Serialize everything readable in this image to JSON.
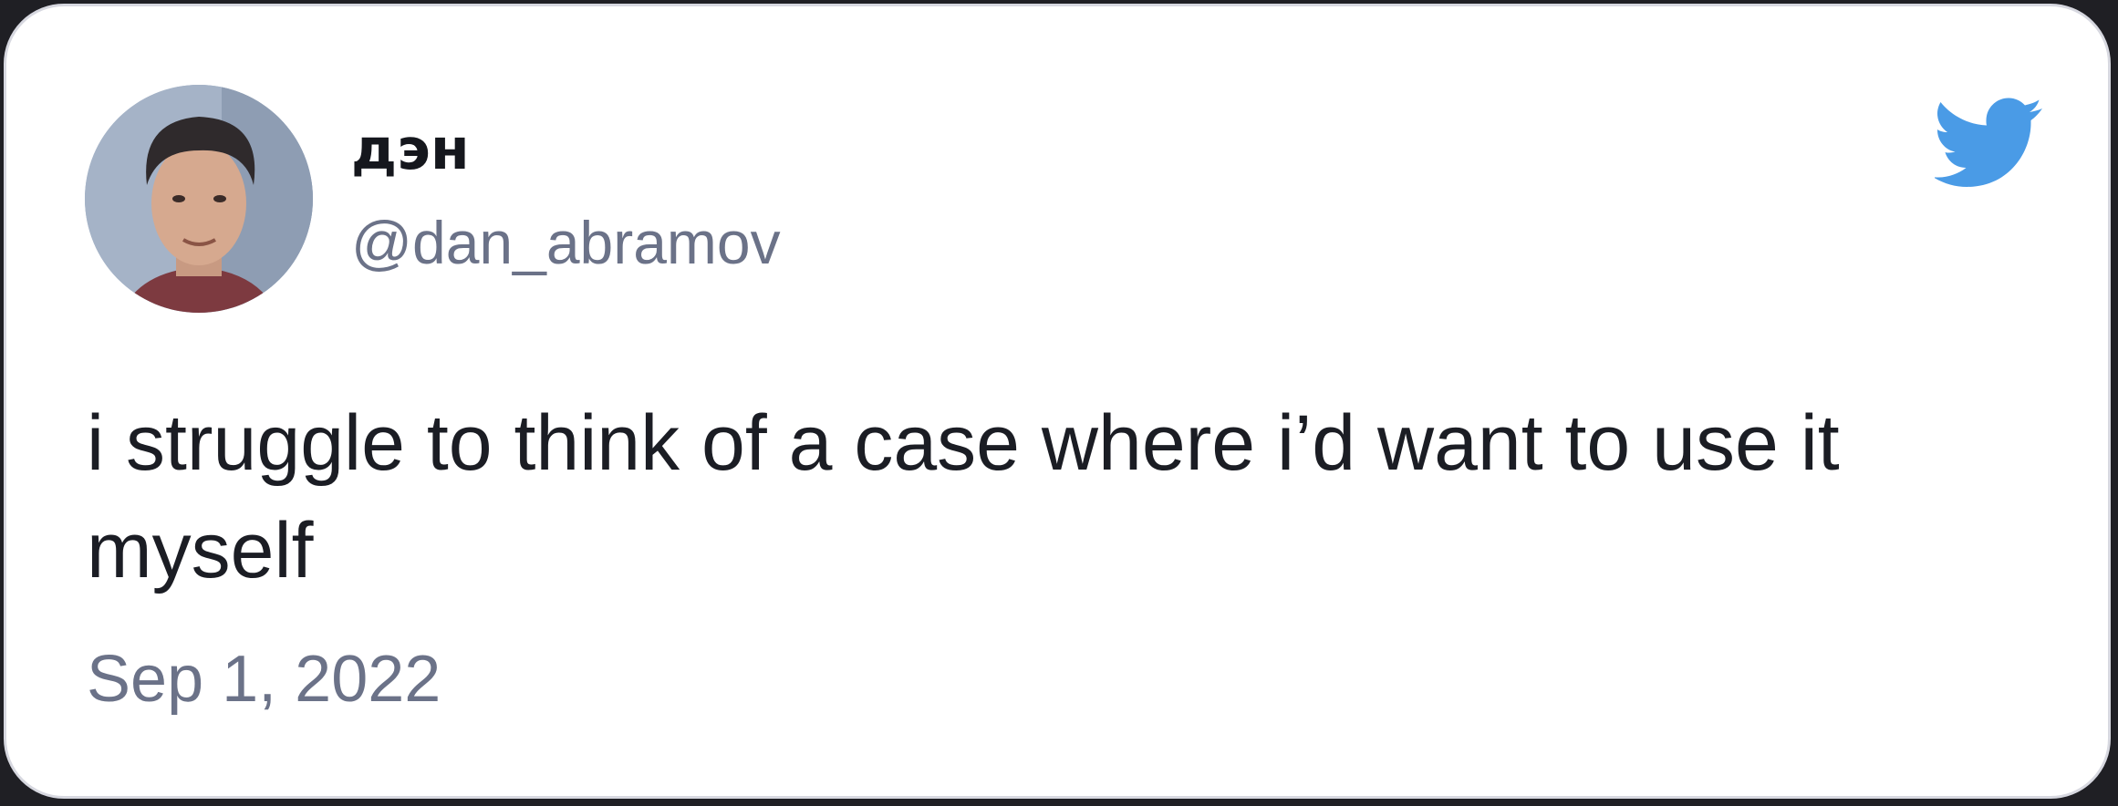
{
  "author": {
    "display_name": "дэн",
    "handle": "@dan_abramov"
  },
  "tweet": {
    "text": "i struggle to think of a case where i’d want to use it myself",
    "date": "Sep 1, 2022"
  },
  "icons": {
    "brand": "twitter-bird-icon",
    "avatar": "avatar"
  },
  "colors": {
    "brand": "#4a9be6",
    "text": "#1b1d24",
    "secondary_text": "#6b7288"
  }
}
